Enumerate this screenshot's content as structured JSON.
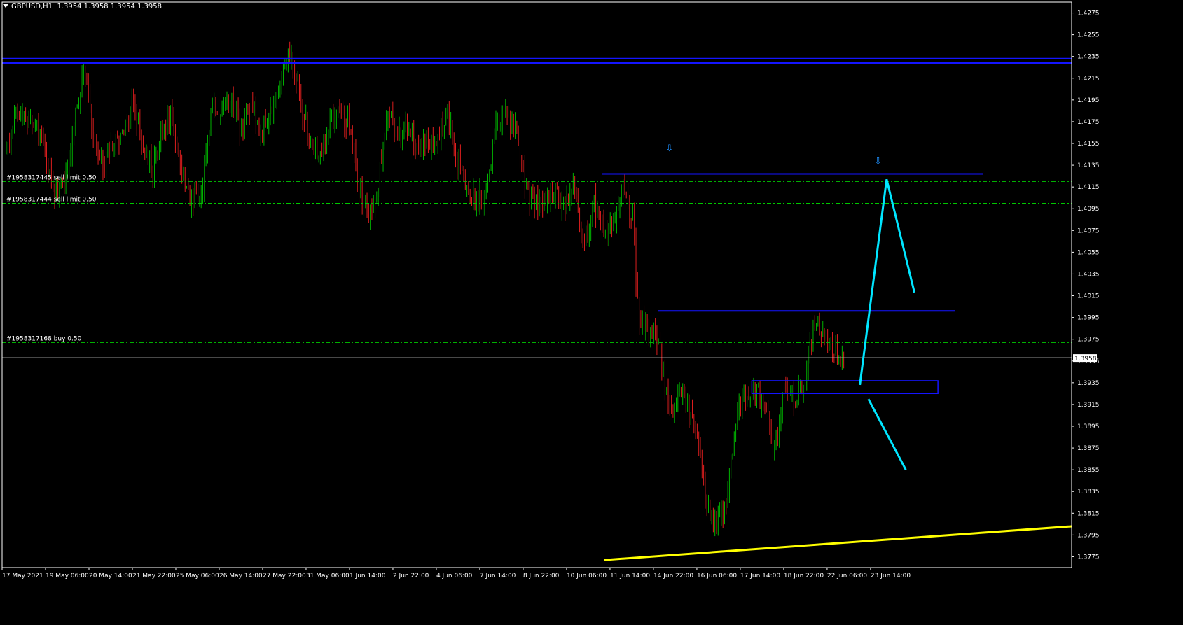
{
  "chart_data": {
    "type": "candlestick",
    "symbol": "GBPUSD,H1",
    "ohlc": [
      "1.3954",
      "1.3958",
      "1.3954",
      "1.3958"
    ],
    "current_price": "1.3958",
    "ylim": [
      1.3765,
      1.4285
    ],
    "y_ticks": [
      "1.4275",
      "1.4255",
      "1.4235",
      "1.4215",
      "1.4195",
      "1.4175",
      "1.4155",
      "1.4135",
      "1.4115",
      "1.4095",
      "1.4075",
      "1.4055",
      "1.4035",
      "1.4015",
      "1.3995",
      "1.3975",
      "1.3955",
      "1.3935",
      "1.3915",
      "1.3895",
      "1.3875",
      "1.3855",
      "1.3835",
      "1.3815",
      "1.3795",
      "1.3775"
    ],
    "x_ticks": [
      "17 May 2021",
      "19 May 06:00",
      "20 May 14:00",
      "21 May 22:00",
      "25 May 06:00",
      "26 May 14:00",
      "27 May 22:00",
      "31 May 06:00",
      "1 Jun 14:00",
      "2 Jun 22:00",
      "4 Jun 06:00",
      "7 Jun 14:00",
      "8 Jun 22:00",
      "10 Jun 06:00",
      "11 Jun 14:00",
      "14 Jun 22:00",
      "16 Jun 06:00",
      "17 Jun 14:00",
      "18 Jun 22:00",
      "22 Jun 06:00",
      "23 Jun 14:00"
    ],
    "price_path": [
      [
        0,
        1.4145
      ],
      [
        2,
        1.419
      ],
      [
        4,
        1.418
      ],
      [
        6,
        1.4175
      ],
      [
        8,
        1.414
      ],
      [
        10,
        1.411
      ],
      [
        12,
        1.412
      ],
      [
        14,
        1.418
      ],
      [
        16,
        1.4225
      ],
      [
        17,
        1.419
      ],
      [
        18,
        1.415
      ],
      [
        20,
        1.4135
      ],
      [
        22,
        1.416
      ],
      [
        24,
        1.4165
      ],
      [
        26,
        1.4195
      ],
      [
        28,
        1.415
      ],
      [
        30,
        1.413
      ],
      [
        32,
        1.4165
      ],
      [
        34,
        1.418
      ],
      [
        36,
        1.412
      ],
      [
        38,
        1.41
      ],
      [
        40,
        1.4115
      ],
      [
        42,
        1.419
      ],
      [
        44,
        1.418
      ],
      [
        46,
        1.42
      ],
      [
        48,
        1.4165
      ],
      [
        50,
        1.4195
      ],
      [
        52,
        1.416
      ],
      [
        54,
        1.4185
      ],
      [
        56,
        1.421
      ],
      [
        58,
        1.424
      ],
      [
        60,
        1.4195
      ],
      [
        62,
        1.416
      ],
      [
        64,
        1.4145
      ],
      [
        66,
        1.4175
      ],
      [
        68,
        1.418
      ],
      [
        70,
        1.4175
      ],
      [
        72,
        1.411
      ],
      [
        74,
        1.409
      ],
      [
        76,
        1.412
      ],
      [
        78,
        1.4185
      ],
      [
        80,
        1.416
      ],
      [
        82,
        1.417
      ],
      [
        84,
        1.415
      ],
      [
        86,
        1.416
      ],
      [
        88,
        1.4155
      ],
      [
        90,
        1.4185
      ],
      [
        92,
        1.414
      ],
      [
        94,
        1.412
      ],
      [
        96,
        1.41
      ],
      [
        98,
        1.411
      ],
      [
        100,
        1.417
      ],
      [
        102,
        1.418
      ],
      [
        104,
        1.417
      ],
      [
        106,
        1.4115
      ],
      [
        108,
        1.41
      ],
      [
        110,
        1.4105
      ],
      [
        112,
        1.411
      ],
      [
        114,
        1.4095
      ],
      [
        116,
        1.4115
      ],
      [
        118,
        1.406
      ],
      [
        120,
        1.41
      ],
      [
        122,
        1.4075
      ],
      [
        124,
        1.408
      ],
      [
        126,
        1.4115
      ],
      [
        128,
        1.408
      ],
      [
        129,
        1.4
      ],
      [
        131,
        1.398
      ],
      [
        133,
        1.3975
      ],
      [
        134,
        1.394
      ],
      [
        136,
        1.391
      ],
      [
        138,
        1.393
      ],
      [
        140,
        1.39
      ],
      [
        142,
        1.387
      ],
      [
        143,
        1.382
      ],
      [
        145,
        1.38
      ],
      [
        147,
        1.383
      ],
      [
        149,
        1.39
      ],
      [
        151,
        1.3925
      ],
      [
        153,
        1.393
      ],
      [
        155,
        1.391
      ],
      [
        157,
        1.3875
      ],
      [
        159,
        1.393
      ],
      [
        161,
        1.392
      ],
      [
        163,
        1.3935
      ],
      [
        165,
        1.3985
      ],
      [
        167,
        1.398
      ],
      [
        169,
        1.3962
      ],
      [
        171,
        1.3958
      ]
    ],
    "levels": [
      {
        "label": "#1958317445 sell limit 0.50",
        "price": 1.412,
        "style": "order"
      },
      {
        "label": "#1958317444 sell limit 0.50",
        "price": 1.41,
        "style": "order"
      },
      {
        "label": "#1958317168 buy 0.50",
        "price": 1.3972,
        "style": "order"
      }
    ],
    "horizontal_lines": [
      {
        "price": 1.4233,
        "color": "#1414ff",
        "x_from": 0,
        "x_to": 1.0
      },
      {
        "price": 1.4229,
        "color": "#1414ff",
        "x_from": 0,
        "x_to": 1.0
      },
      {
        "price": 1.4127,
        "color": "#1414ff",
        "x_from": 0.561,
        "x_to": 0.917
      },
      {
        "price": 1.4001,
        "color": "#1414ff",
        "x_from": 0.613,
        "x_to": 0.891
      }
    ],
    "zone": {
      "price_top": 1.3933,
      "price_bottom": 1.3927,
      "x_from": 0.701,
      "x_to": 0.875,
      "color": "#1414ff"
    },
    "arrows": [
      {
        "x": 0.624,
        "price": 1.4148,
        "glyph": "⇩"
      },
      {
        "x": 0.819,
        "price": 1.4136,
        "glyph": "⇩"
      }
    ],
    "projection_up": [
      [
        0.802,
        1.3933
      ],
      [
        0.827,
        1.4122
      ],
      [
        0.853,
        1.4018
      ]
    ],
    "projection_down": [
      [
        0.81,
        1.392
      ],
      [
        0.845,
        1.3855
      ]
    ],
    "trendline": {
      "from": [
        0.563,
        1.3772
      ],
      "to": [
        1.0,
        1.3803
      ],
      "color": "#ffff00"
    },
    "colors": {
      "background": "#000000",
      "bull": "#00b400",
      "bear": "#dc1e1e",
      "order": "#00c800",
      "level": "#1414ff",
      "projection": "#00e5ff",
      "trend": "#ffff00",
      "axis": "#ffffff",
      "price_line": "#c0c0c0"
    }
  }
}
